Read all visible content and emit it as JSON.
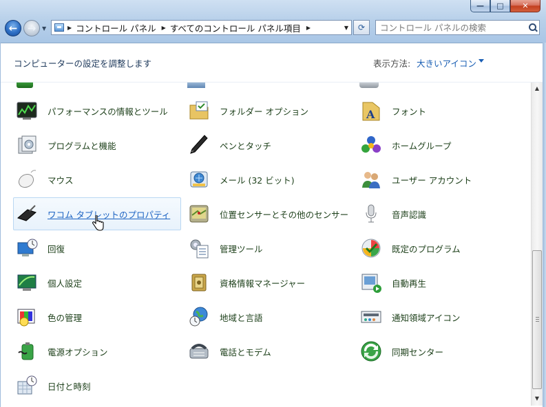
{
  "window": {
    "minimize_glyph": "—",
    "maximize_glyph": "□",
    "close_glyph": "✕"
  },
  "nav": {
    "back_glyph": "←",
    "forward_glyph": "→"
  },
  "address": {
    "crumbs": [
      "コントロール パネル",
      "すべてのコントロール パネル項目"
    ]
  },
  "search": {
    "placeholder": "コントロール パネルの検索"
  },
  "header": {
    "title": "コンピューターの設定を調整します",
    "view_label": "表示方法:",
    "view_value": "大きいアイコン"
  },
  "items": [
    {
      "label": "パフォーマンスの情報とツール",
      "icon": "performance-icon"
    },
    {
      "label": "フォルダー オプション",
      "icon": "folder-options-icon"
    },
    {
      "label": "フォント",
      "icon": "fonts-icon"
    },
    {
      "label": "プログラムと機能",
      "icon": "programs-icon"
    },
    {
      "label": "ペンとタッチ",
      "icon": "pen-touch-icon"
    },
    {
      "label": "ホームグループ",
      "icon": "homegroup-icon"
    },
    {
      "label": "マウス",
      "icon": "mouse-icon"
    },
    {
      "label": "メール (32 ビット)",
      "icon": "mail-icon"
    },
    {
      "label": "ユーザー アカウント",
      "icon": "user-accounts-icon"
    },
    {
      "label": "ワコム タブレットのプロパティ",
      "icon": "wacom-tablet-icon"
    },
    {
      "label": "位置センサーとその他のセンサー",
      "icon": "location-sensor-icon"
    },
    {
      "label": "音声認識",
      "icon": "speech-recognition-icon"
    },
    {
      "label": "回復",
      "icon": "recovery-icon"
    },
    {
      "label": "管理ツール",
      "icon": "admin-tools-icon"
    },
    {
      "label": "既定のプログラム",
      "icon": "default-programs-icon"
    },
    {
      "label": "個人設定",
      "icon": "personalization-icon"
    },
    {
      "label": "資格情報マネージャー",
      "icon": "credential-manager-icon"
    },
    {
      "label": "自動再生",
      "icon": "autoplay-icon"
    },
    {
      "label": "色の管理",
      "icon": "color-management-icon"
    },
    {
      "label": "地域と言語",
      "icon": "region-language-icon"
    },
    {
      "label": "通知領域アイコン",
      "icon": "notification-area-icon"
    },
    {
      "label": "電源オプション",
      "icon": "power-options-icon"
    },
    {
      "label": "電話とモデム",
      "icon": "phone-modem-icon"
    },
    {
      "label": "同期センター",
      "icon": "sync-center-icon"
    },
    {
      "label": "日付と時刻",
      "icon": "date-time-icon"
    }
  ],
  "scrollbar": {
    "up_glyph": "▲",
    "down_glyph": "▼"
  }
}
